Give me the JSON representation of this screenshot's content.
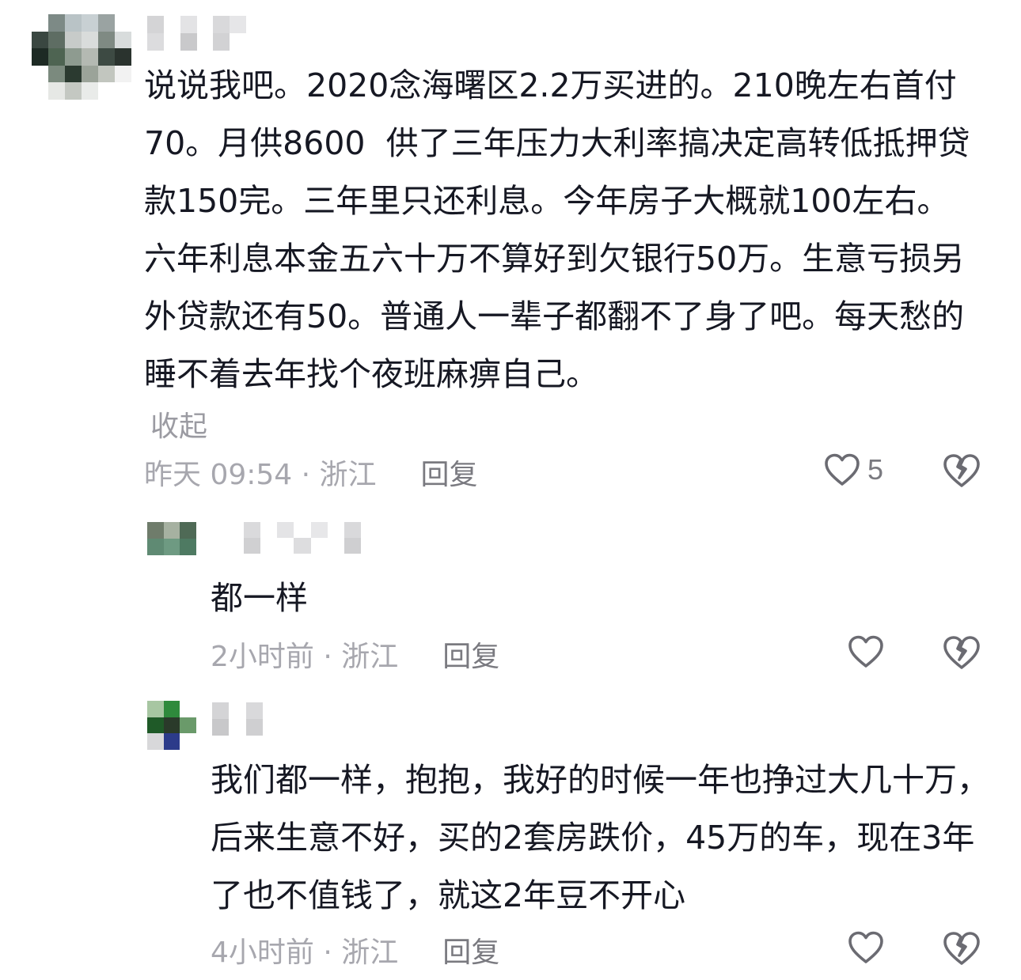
{
  "main_comment": {
    "text": "说说我吧。2020念海曙区2.2万买进的。210晚左右首付70。月供8600  供了三年压力大利率搞决定高转低抵押贷款150完。三年里只还利息。今年房子大概就100左右。六年利息本金五六十万不算好到欠银行50万。生意亏损另外贷款还有50。普通人一辈子都翻不了身了吧。每天愁的睡不着去年找个夜班麻痹自己。",
    "collapse_label": "收起",
    "time_location": "昨天 09:54 · 浙江",
    "reply_label": "回复",
    "like_count": "5"
  },
  "replies": [
    {
      "text": "都一样",
      "time_location": "2小时前 · 浙江",
      "reply_label": "回复"
    },
    {
      "text": "我们都一样，抱抱，我好的时候一年也挣过大几十万，后来生意不好，买的2套房跌价，45万的车，现在3年了也不值钱了，就这2年豆不开心",
      "time_location": "4小时前 · 浙江",
      "reply_label": "回复"
    }
  ],
  "icons": {
    "like": "heart-outline-icon",
    "dislike": "broken-heart-icon"
  },
  "colors": {
    "text": "#161823",
    "meta_text": "#a7a7ae",
    "reply_text": "#7a7a80",
    "icon_stroke": "#6b6b72"
  }
}
